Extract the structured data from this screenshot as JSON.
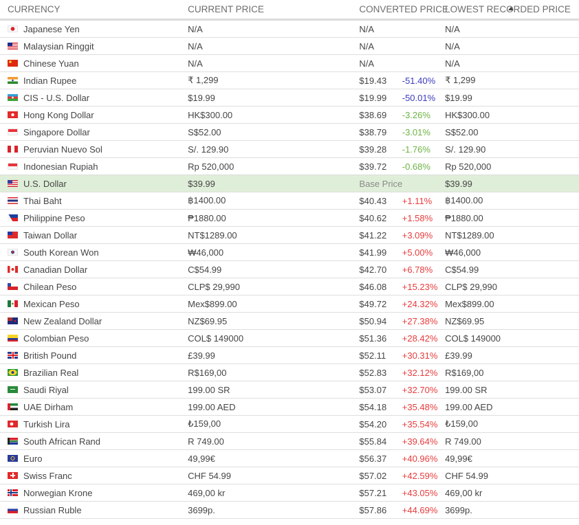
{
  "headers": {
    "currency": "CURRENCY",
    "current_price": "CURRENT PRICE",
    "converted_price": "CONVERTED PRICE",
    "lowest_recorded_price": "LOWEST RECORDED PRICE"
  },
  "colors": {
    "base_row_bg": "#dfeed8",
    "pct_large_discount": "#3b3bbf",
    "pct_discount": "#6cb344",
    "pct_increase": "#e83c3c"
  },
  "rows": [
    {
      "flag": "jp-flag-icon",
      "currency": "Japanese Yen",
      "current": "N/A",
      "converted": "N/A",
      "pct": "",
      "pct_class": "",
      "lowest": "N/A"
    },
    {
      "flag": "my-flag-icon",
      "currency": "Malaysian Ringgit",
      "current": "N/A",
      "converted": "N/A",
      "pct": "",
      "pct_class": "",
      "lowest": "N/A"
    },
    {
      "flag": "cn-flag-icon",
      "currency": "Chinese Yuan",
      "current": "N/A",
      "converted": "N/A",
      "pct": "",
      "pct_class": "",
      "lowest": "N/A"
    },
    {
      "flag": "in-flag-icon",
      "currency": "Indian Rupee",
      "current": "₹ 1,299",
      "converted": "$19.43",
      "pct": "-51.40%",
      "pct_class": "pct-blue",
      "lowest": "₹ 1,299"
    },
    {
      "flag": "az-flag-icon",
      "currency": "CIS - U.S. Dollar",
      "current": "$19.99",
      "converted": "$19.99",
      "pct": "-50.01%",
      "pct_class": "pct-blue",
      "lowest": "$19.99"
    },
    {
      "flag": "hk-flag-icon",
      "currency": "Hong Kong Dollar",
      "current": "HK$300.00",
      "converted": "$38.69",
      "pct": "-3.26%",
      "pct_class": "pct-green",
      "lowest": "HK$300.00"
    },
    {
      "flag": "sg-flag-icon",
      "currency": "Singapore Dollar",
      "current": "S$52.00",
      "converted": "$38.79",
      "pct": "-3.01%",
      "pct_class": "pct-green",
      "lowest": "S$52.00"
    },
    {
      "flag": "pe-flag-icon",
      "currency": "Peruvian Nuevo Sol",
      "current": "S/. 129.90",
      "converted": "$39.28",
      "pct": "-1.76%",
      "pct_class": "pct-green",
      "lowest": "S/. 129.90"
    },
    {
      "flag": "id-flag-icon",
      "currency": "Indonesian Rupiah",
      "current": "Rp 520,000",
      "converted": "$39.72",
      "pct": "-0.68%",
      "pct_class": "pct-green",
      "lowest": "Rp 520,000"
    },
    {
      "flag": "us-flag-icon",
      "currency": "U.S. Dollar",
      "current": "$39.99",
      "converted": "Base Price",
      "pct": "",
      "pct_class": "",
      "lowest": "$39.99",
      "base": true
    },
    {
      "flag": "th-flag-icon",
      "currency": "Thai Baht",
      "current": "฿1400.00",
      "converted": "$40.43",
      "pct": "+1.11%",
      "pct_class": "pct-red",
      "lowest": "฿1400.00"
    },
    {
      "flag": "ph-flag-icon",
      "currency": "Philippine Peso",
      "current": "₱1880.00",
      "converted": "$40.62",
      "pct": "+1.58%",
      "pct_class": "pct-red",
      "lowest": "₱1880.00"
    },
    {
      "flag": "tw-flag-icon",
      "currency": "Taiwan Dollar",
      "current": "NT$1289.00",
      "converted": "$41.22",
      "pct": "+3.09%",
      "pct_class": "pct-red",
      "lowest": "NT$1289.00"
    },
    {
      "flag": "kr-flag-icon",
      "currency": "South Korean Won",
      "current": "₩46,000",
      "converted": "$41.99",
      "pct": "+5.00%",
      "pct_class": "pct-red",
      "lowest": "₩46,000"
    },
    {
      "flag": "ca-flag-icon",
      "currency": "Canadian Dollar",
      "current": "C$54.99",
      "converted": "$42.70",
      "pct": "+6.78%",
      "pct_class": "pct-red",
      "lowest": "C$54.99"
    },
    {
      "flag": "cl-flag-icon",
      "currency": "Chilean Peso",
      "current": "CLP$ 29,990",
      "converted": "$46.08",
      "pct": "+15.23%",
      "pct_class": "pct-red",
      "lowest": "CLP$ 29,990"
    },
    {
      "flag": "mx-flag-icon",
      "currency": "Mexican Peso",
      "current": "Mex$899.00",
      "converted": "$49.72",
      "pct": "+24.32%",
      "pct_class": "pct-red",
      "lowest": "Mex$899.00"
    },
    {
      "flag": "nz-flag-icon",
      "currency": "New Zealand Dollar",
      "current": "NZ$69.95",
      "converted": "$50.94",
      "pct": "+27.38%",
      "pct_class": "pct-red",
      "lowest": "NZ$69.95"
    },
    {
      "flag": "co-flag-icon",
      "currency": "Colombian Peso",
      "current": "COL$ 149000",
      "converted": "$51.36",
      "pct": "+28.42%",
      "pct_class": "pct-red",
      "lowest": "COL$ 149000"
    },
    {
      "flag": "gb-flag-icon",
      "currency": "British Pound",
      "current": "£39.99",
      "converted": "$52.11",
      "pct": "+30.31%",
      "pct_class": "pct-red",
      "lowest": "£39.99"
    },
    {
      "flag": "br-flag-icon",
      "currency": "Brazilian Real",
      "current": "R$169,00",
      "converted": "$52.83",
      "pct": "+32.12%",
      "pct_class": "pct-red",
      "lowest": "R$169,00"
    },
    {
      "flag": "sa-flag-icon",
      "currency": "Saudi Riyal",
      "current": "199.00 SR",
      "converted": "$53.07",
      "pct": "+32.70%",
      "pct_class": "pct-red",
      "lowest": "199.00 SR"
    },
    {
      "flag": "ae-flag-icon",
      "currency": "UAE Dirham",
      "current": "199.00 AED",
      "converted": "$54.18",
      "pct": "+35.48%",
      "pct_class": "pct-red",
      "lowest": "199.00 AED"
    },
    {
      "flag": "tr-flag-icon",
      "currency": "Turkish Lira",
      "current": "₺159,00",
      "converted": "$54.20",
      "pct": "+35.54%",
      "pct_class": "pct-red",
      "lowest": "₺159,00"
    },
    {
      "flag": "za-flag-icon",
      "currency": "South African Rand",
      "current": "R 749.00",
      "converted": "$55.84",
      "pct": "+39.64%",
      "pct_class": "pct-red",
      "lowest": "R 749.00"
    },
    {
      "flag": "eu-flag-icon",
      "currency": "Euro",
      "current": "49,99€",
      "converted": "$56.37",
      "pct": "+40.96%",
      "pct_class": "pct-red",
      "lowest": "49,99€"
    },
    {
      "flag": "ch-flag-icon",
      "currency": "Swiss Franc",
      "current": "CHF 54.99",
      "converted": "$57.02",
      "pct": "+42.59%",
      "pct_class": "pct-red",
      "lowest": "CHF 54.99"
    },
    {
      "flag": "no-flag-icon",
      "currency": "Norwegian Krone",
      "current": "469,00 kr",
      "converted": "$57.21",
      "pct": "+43.05%",
      "pct_class": "pct-red",
      "lowest": "469,00 kr"
    },
    {
      "flag": "ru-flag-icon",
      "currency": "Russian Ruble",
      "current": "3699p.",
      "converted": "$57.86",
      "pct": "+44.69%",
      "pct_class": "pct-red",
      "lowest": "3699p."
    }
  ]
}
